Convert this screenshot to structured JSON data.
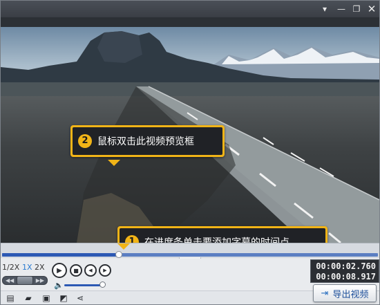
{
  "titlebar": {
    "menu_icon": "dropdown-triangle-icon",
    "minimize_icon": "minimize-icon",
    "restore_icon": "restore-icon",
    "close_icon": "close-icon"
  },
  "callouts": [
    {
      "number": "2",
      "text": "鼠标双击此视频预览框"
    },
    {
      "number": "1",
      "text": "在进度条单击要添加字幕的时间点"
    }
  ],
  "timeline": {
    "progress": 0.31
  },
  "speed": {
    "options": [
      "1/2X",
      "1X",
      "2X"
    ],
    "selected": "1X"
  },
  "volume": {
    "level": 0.98
  },
  "time": {
    "current": "00:00:02.760",
    "total": "00:00:08.917"
  },
  "toolbar": {
    "icons": [
      "new-project-icon",
      "open-folder-icon",
      "save-icon",
      "save-as-icon",
      "share-icon"
    ]
  },
  "export": {
    "label": "导出视频"
  },
  "colors": {
    "accent_yellow": "#f1b417",
    "timeline_blue": "#2c59b4",
    "callout_bg": "#202226"
  }
}
